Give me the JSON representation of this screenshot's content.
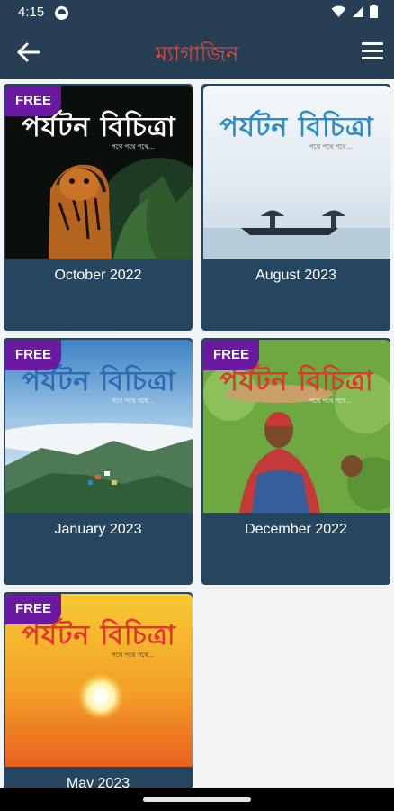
{
  "status_bar": {
    "time": "4:15"
  },
  "app_bar": {
    "title": "ম্যাগাজিন"
  },
  "magazines": [
    {
      "label": "October 2022",
      "badge": "FREE",
      "masthead": "পর্যটন বিচিত্রা",
      "tagline": "পথে পথে পথে..."
    },
    {
      "label": "August 2023",
      "badge": "",
      "masthead": "পর্যটন বিচিত্রা",
      "tagline": "পথে পথে পথে..."
    },
    {
      "label": "January 2023",
      "badge": "FREE",
      "masthead": "পর্যটন বিচিত্রা",
      "tagline": "পথে পথে পথে..."
    },
    {
      "label": "December 2022",
      "badge": "FREE",
      "masthead": "পর্যটন বিচিত্রা",
      "tagline": "পথে পথে পথে..."
    },
    {
      "label": "May 2023",
      "badge": "FREE",
      "masthead": "পর্যটন বিচিত্রা",
      "tagline": "পথে পথে পথে..."
    }
  ],
  "colors": {
    "appbar": "#263f55",
    "title": "#e8463a",
    "card": "#26455e",
    "badge": "#6a1aa0",
    "masthead_light": "#ffffff",
    "masthead_red": "#e3342f",
    "masthead_blue": "#2a8cc9"
  }
}
